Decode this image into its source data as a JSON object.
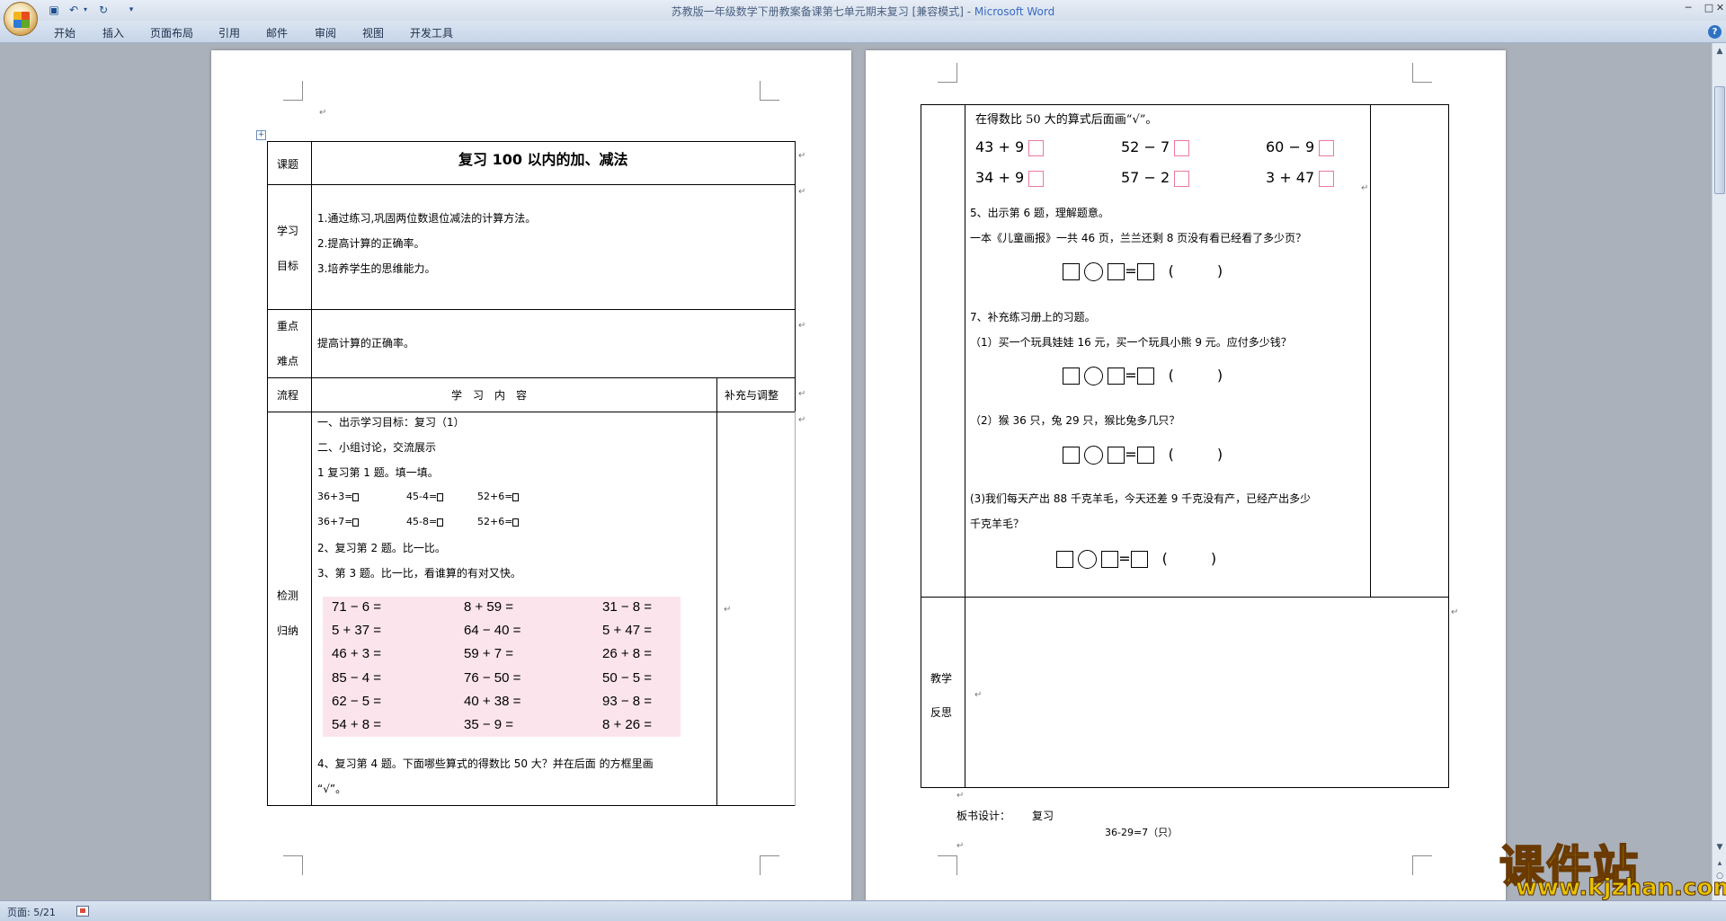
{
  "window": {
    "title_doc": "苏教版一年级数学下册教案备课第七单元期末复习 [兼容模式] - ",
    "title_app": "Microsoft Word",
    "min": "─",
    "max": "□",
    "close": "✕"
  },
  "quick_access": {
    "save_icon": "save-icon",
    "undo_icon": "undo-icon",
    "redo_icon": "redo-icon",
    "customize_icon": "customize-icon"
  },
  "ribbon": {
    "tabs": [
      "开始",
      "插入",
      "页面布局",
      "引用",
      "邮件",
      "审阅",
      "视图",
      "开发工具"
    ],
    "help": "?"
  },
  "statusbar": {
    "page": "页面: 5/21"
  },
  "watermark": {
    "title": "课件站",
    "url": "www.kjzhan.com"
  },
  "left_page": {
    "label_topic": "课题",
    "title": "复习 100 以内的加、减法",
    "label_goal_1": "学习",
    "label_goal_2": "目标",
    "goals": [
      "1.通过练习,巩固两位数退位减法的计算方法。",
      "2.提高计算的正确率。",
      "3.培养学生的思维能力。"
    ],
    "label_key_1": "重点",
    "label_key_2": "难点",
    "key_text": "提高计算的正确率。",
    "label_flow": "流程",
    "header_content": "学　习　内　容",
    "header_supplement": "补充与调整",
    "label_check_1": "检测",
    "label_check_2": "归纳",
    "steps": [
      "一、出示学习目标：复习（1）",
      "二、小组讨论，交流展示",
      "1 复习第 1 题。填一填。"
    ],
    "fill_row1": [
      "36+3=",
      "45-4=",
      "52+6="
    ],
    "fill_row2": [
      "36+7=",
      "45-8=",
      "52+6="
    ],
    "step2": "2、复习第 2 题。比一比。",
    "step3": "3、第 3 题。比一比，看谁算的有对又快。",
    "problems": [
      [
        "71 − 6 =",
        "8 + 59 =",
        "31 − 8 ="
      ],
      [
        "5 + 37 =",
        "64 − 40 =",
        "5 + 47 ="
      ],
      [
        "46 + 3 =",
        "59 + 7 =",
        "26 + 8 ="
      ],
      [
        "85 − 4 =",
        "76 − 50 =",
        "50 − 5 ="
      ],
      [
        "62 − 5 =",
        "40 + 38 =",
        "93 − 8 ="
      ],
      [
        "54 + 8 =",
        "35 − 9 =",
        "8 + 26 ="
      ]
    ],
    "step4_line1": "4、复习第 4 题。下面哪些算式的得数比 50 大？并在后面 的方框里画",
    "step4_line2": "“√”。"
  },
  "right_page": {
    "intro": "在得数比 50 大的算式后面画“√”。",
    "check_row1": [
      "43 + 9",
      "52 − 7",
      "60 − 9"
    ],
    "check_row2": [
      "34 + 9",
      "57 − 2",
      "3 + 47"
    ],
    "q5": "5、出示第 6 题，理解题意。",
    "q5_text": "一本《儿童画报》一共 46 页，兰兰还剩 8 页没有看已经看了多少页？",
    "q7": "7、补充练习册上的习题。",
    "q7_1": "（1）买一个玩具娃娃 16 元，买一个玩具小熊 9 元。应付多少钱？",
    "q7_2": "（2）猴 36 只，兔 29 只，猴比兔多几只？",
    "q7_3a": "(3)我们每天产出 88 千克羊毛，今天还差 9 千克没有产，已经产出多少",
    "q7_3b": "千克羊毛？",
    "paren": "(　　　)",
    "label_reflect_1": "教学",
    "label_reflect_2": "反思",
    "board_label": "板书设计：",
    "board_value": "复习",
    "board_eq": "36-29=7（只）"
  }
}
